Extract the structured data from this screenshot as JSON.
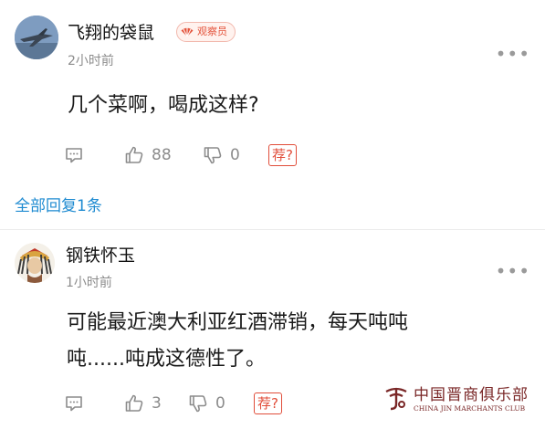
{
  "comments": [
    {
      "username": "飞翔的袋鼠",
      "badge": "观察员",
      "time": "2小时前",
      "content": "几个菜啊，喝成这样?",
      "like_count": "88",
      "dislike_count": "0",
      "recommend_label": "荐?",
      "replies_link": "全部回复1条"
    },
    {
      "username": "钢铁怀玉",
      "time": "1小时前",
      "content_line1": "可能最近澳大利亚红酒滞销，每天吨吨",
      "content_line2": "吨......吨成这德性了。",
      "like_count": "3",
      "dislike_count": "0",
      "recommend_label": "荐?"
    }
  ],
  "watermark": {
    "name": "中国晋商俱乐部",
    "en": "CHINA JIN MARCHANTS CLUB"
  },
  "icons": [
    "comment-icon",
    "thumbs-up-icon",
    "thumbs-down-icon",
    "more-icon",
    "fan-badge-icon"
  ],
  "colors": {
    "accent_red": "#e14d3a",
    "link_blue": "#1f8bd1",
    "muted": "#8c8c8c"
  }
}
